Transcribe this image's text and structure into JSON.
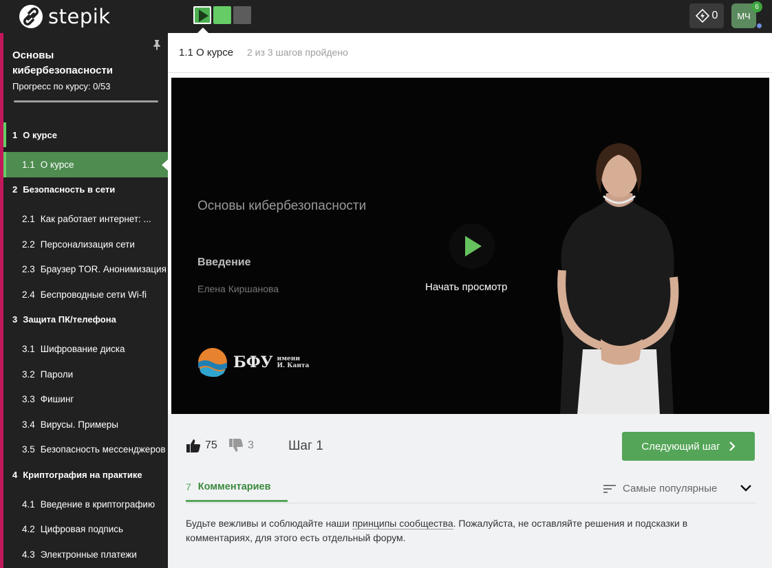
{
  "topbar": {
    "logo_text": "stepik",
    "energy_count": "0",
    "avatar_initials": "МЧ",
    "notification_count": "6"
  },
  "sidebar": {
    "course_title": "Основы кибербезопасности",
    "progress_label": "Прогресс по курсу:  0/53",
    "progress_fraction": 0,
    "modules": [
      {
        "num": "1",
        "title": "О курсе",
        "lessons": [
          {
            "num": "1.1",
            "title": "О курсе",
            "active": true
          }
        ]
      },
      {
        "num": "2",
        "title": "Безопасность в сети",
        "lessons": [
          {
            "num": "2.1",
            "title": "Как работает интернет: ..."
          },
          {
            "num": "2.2",
            "title": "Персонализация сети"
          },
          {
            "num": "2.3",
            "title": "Браузер TOR. Анонимизация"
          },
          {
            "num": "2.4",
            "title": "Беспроводные сети Wi-fi"
          }
        ]
      },
      {
        "num": "3",
        "title": "Защита ПК/телефона",
        "lessons": [
          {
            "num": "3.1",
            "title": "Шифрование диска"
          },
          {
            "num": "3.2",
            "title": "Пароли"
          },
          {
            "num": "3.3",
            "title": "Фишинг"
          },
          {
            "num": "3.4",
            "title": "Вирусы. Примеры"
          },
          {
            "num": "3.5",
            "title": "Безопасность мессенджеров"
          }
        ]
      },
      {
        "num": "4",
        "title": "Криптография на практике",
        "lessons": [
          {
            "num": "4.1",
            "title": "Введение в криптографию"
          },
          {
            "num": "4.2",
            "title": "Цифровая подпись"
          },
          {
            "num": "4.3",
            "title": "Электронные платежи"
          }
        ]
      }
    ]
  },
  "header": {
    "lesson_name": "1.1 О курсе",
    "steps_progress": "2 из 3 шагов пройдено"
  },
  "video": {
    "title": "Основы кибербезопасности",
    "subtitle": "Введение",
    "author": "Елена Киршанова",
    "start_label": "Начать просмотр",
    "logo_text": "БФУ",
    "logo_small_1": "имени",
    "logo_small_2": "И. Канта"
  },
  "actions": {
    "likes": "75",
    "dislikes": "3",
    "step_label": "Шаг 1",
    "next_label": "Следующий шаг"
  },
  "comments": {
    "count": "7",
    "label": "Комментариев",
    "sort_label": "Самые популярные",
    "rules_before": "Будьте вежливы и соблюдайте наши ",
    "rules_link": "принципы сообщества",
    "rules_after": ". Пожалуйста, не оставляйте решения и подсказки в комментариях, для этого есть отдельный форум."
  }
}
